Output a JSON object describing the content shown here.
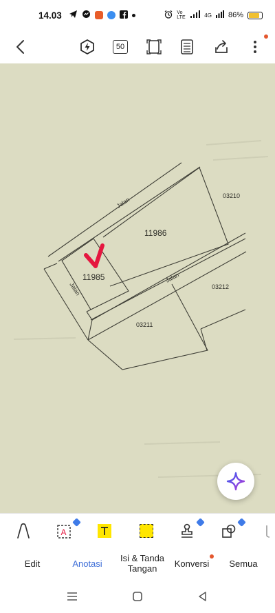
{
  "status_bar": {
    "time": "14.03",
    "battery_percent": "86%",
    "network": "4G",
    "volte": "Vo LTE"
  },
  "toolbar": {
    "page_count": "50"
  },
  "document": {
    "labels": {
      "parcel_11986": "11986",
      "parcel_11985": "11985",
      "parcel_03210": "03210",
      "parcel_03212": "03212",
      "parcel_03211": "03211",
      "road_top": "Jalan",
      "road_middle": "Jalan",
      "road_left": "Jalan"
    },
    "annotation_color": "#e5173f"
  },
  "tabs": {
    "edit": "Edit",
    "annotate": "Anotasi",
    "sign": "Isi & Tanda Tangan",
    "convert": "Konversi",
    "all": "Semua"
  },
  "colors": {
    "accent": "#3f6fd8",
    "highlight": "#ffe600",
    "badge_blue": "#3f7be8",
    "notification_red": "#e4572e",
    "paper": "#dcdcc2"
  }
}
